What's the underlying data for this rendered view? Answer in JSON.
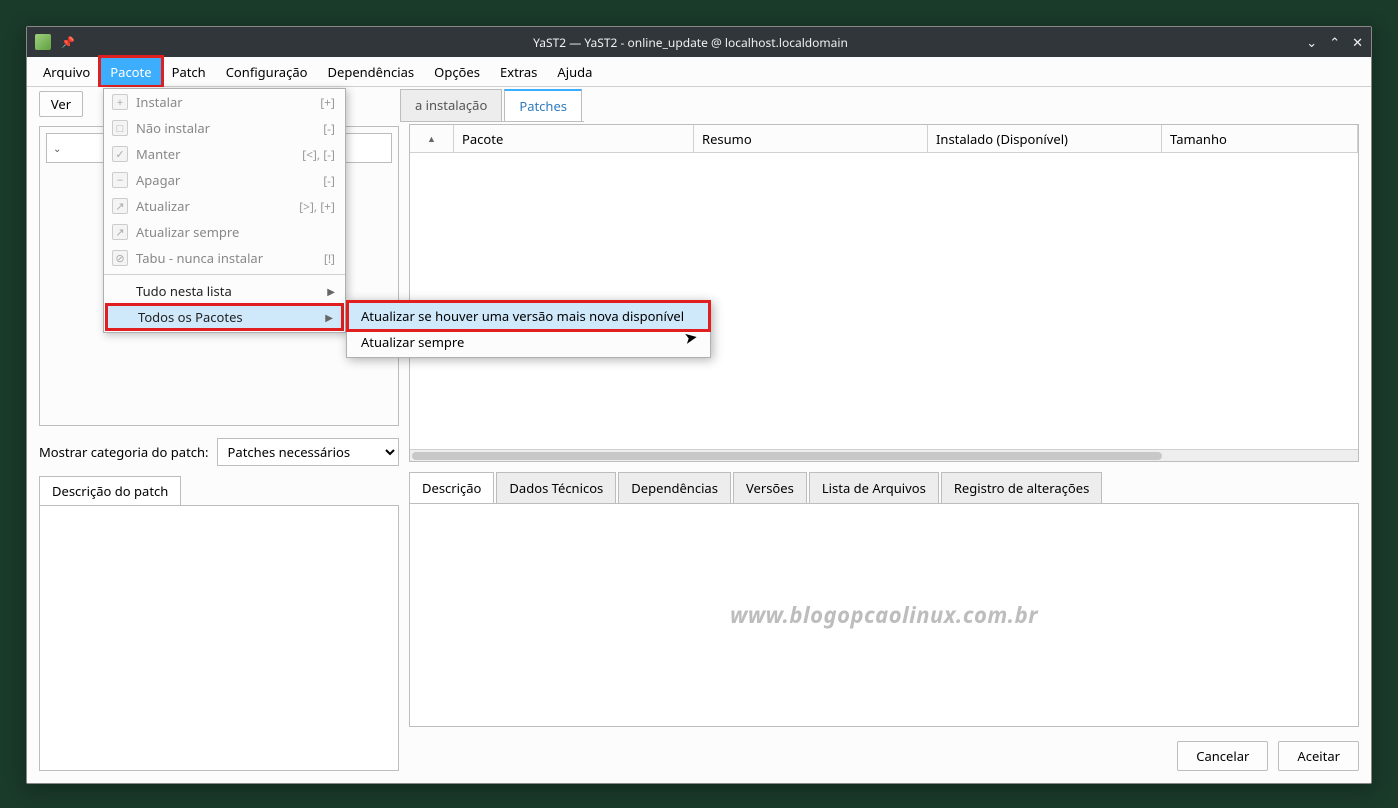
{
  "window": {
    "title": "YaST2 — YaST2 - online_update @ localhost.localdomain"
  },
  "menubar": {
    "items": [
      "Arquivo",
      "Pacote",
      "Patch",
      "Configuração",
      "Dependências",
      "Opções",
      "Extras",
      "Ajuda"
    ],
    "active_index": 1
  },
  "view_button": "Ver",
  "tabs_top": {
    "partial": "a instalação",
    "active": "Patches"
  },
  "dropdown": {
    "items": [
      {
        "icon": "+",
        "label": "Instalar",
        "shortcut": "[+]"
      },
      {
        "icon": "□",
        "label": "Não instalar",
        "shortcut": "[-]"
      },
      {
        "icon": "✓",
        "label": "Manter",
        "shortcut": "[<], [-]"
      },
      {
        "icon": "−",
        "label": "Apagar",
        "shortcut": "[-]"
      },
      {
        "icon": "↗",
        "label": "Atualizar",
        "shortcut": "[>], [+]"
      },
      {
        "icon": "↗",
        "label": "Atualizar sempre",
        "shortcut": ""
      },
      {
        "icon": "⊘",
        "label": "Tabu - nunca instalar",
        "shortcut": "[!]"
      }
    ],
    "sub1": "Tudo nesta lista",
    "sub2": "Todos os Pacotes"
  },
  "submenu": {
    "item1": "Atualizar se houver uma versão mais nova disponível",
    "item2": "Atualizar sempre"
  },
  "table": {
    "headers": {
      "pacote": "Pacote",
      "resumo": "Resumo",
      "instalado": "Instalado (Disponível)",
      "tamanho": "Tamanho"
    }
  },
  "patch_category": {
    "label": "Mostrar categoria do patch:",
    "selected": "Patches necessários"
  },
  "desc_tab": "Descrição do patch",
  "bottom_tabs": [
    "Descrição",
    "Dados Técnicos",
    "Dependências",
    "Versões",
    "Lista de Arquivos",
    "Registro de alterações"
  ],
  "watermark": "www.blogopcaolinux.com.br",
  "footer": {
    "cancel": "Cancelar",
    "accept": "Aceitar"
  }
}
